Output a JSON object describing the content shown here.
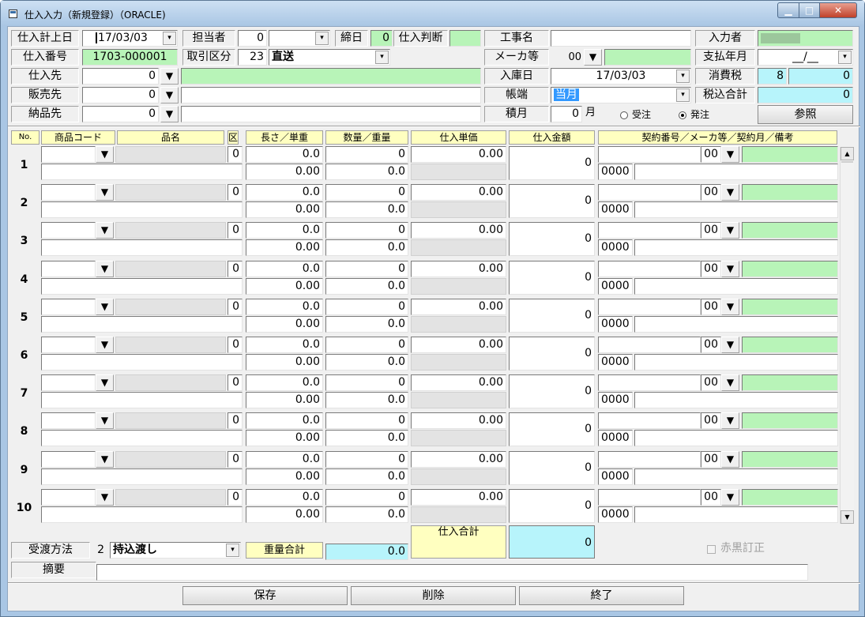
{
  "window": {
    "title": "仕入入力（新規登録）（ORACLE)",
    "minimize": "▁",
    "maximize": "□",
    "close": "✕"
  },
  "header": {
    "shiire_keijo_label": "仕入計上日",
    "shiire_keijo_value": "17/03/03",
    "tantosha_label": "担当者",
    "tantosha_code": "0",
    "tantosha_name": "",
    "shime_label": "締日",
    "shime_value": "0",
    "handan_label": "仕入判断",
    "handan_value": "",
    "koji_label": "工事名",
    "koji_value": "",
    "nyuryoku_label": "入力者",
    "nyuryoku_value": "",
    "bango_label": "仕入番号",
    "bango_value": "1703-000001",
    "torihiki_label": "取引区分",
    "torihiki_code": "23",
    "torihiki_name": "直送",
    "maker_label": "メーカ等",
    "maker_code": "00",
    "maker_name": "",
    "shiharai_label": "支払年月",
    "shiharai_value": "__/__",
    "shiiresaki_label": "仕入先",
    "shiiresaki_code": "0",
    "shiiresaki_name": "",
    "nyuko_label": "入庫日",
    "nyuko_value": "17/03/03",
    "shohizei_label": "消費税",
    "shohizei_rate": "8",
    "shohizei_value": "0",
    "hanbai_label": "販売先",
    "hanbai_code": "0",
    "hanbai_name": "",
    "chobo_label": "帳端",
    "chobo_value": "当月",
    "zeikomi_label": "税込合計",
    "zeikomi_value": "0",
    "nohin_label": "納品先",
    "nohin_code": "0",
    "nohin_name": "",
    "tsumitsuki_label": "積月",
    "tsumitsuki_value": "0",
    "tsumitsuki_unit": "月",
    "radio_juchu": "受注",
    "radio_hatchu": "発注",
    "radio_selected": "発注",
    "sansho_button": "参照"
  },
  "grid": {
    "headers": [
      "No.",
      "商品コード",
      "品名",
      "区",
      "長さ／単重",
      "数量／重量",
      "仕入単価",
      "仕入金額",
      "契約番号／メーカ等／契約月／備考"
    ],
    "rows": [
      {
        "no": "1",
        "ku": "0",
        "nagasa": "0.0",
        "suryo": "0",
        "tanka": "0.00",
        "kingaku": "0",
        "maker": "00",
        "tanju": "0.00",
        "juryo": "0.0",
        "keiyaku": "0000"
      },
      {
        "no": "2",
        "ku": "0",
        "nagasa": "0.0",
        "suryo": "0",
        "tanka": "0.00",
        "kingaku": "0",
        "maker": "00",
        "tanju": "0.00",
        "juryo": "0.0",
        "keiyaku": "0000"
      },
      {
        "no": "3",
        "ku": "0",
        "nagasa": "0.0",
        "suryo": "0",
        "tanka": "0.00",
        "kingaku": "0",
        "maker": "00",
        "tanju": "0.00",
        "juryo": "0.0",
        "keiyaku": "0000"
      },
      {
        "no": "4",
        "ku": "0",
        "nagasa": "0.0",
        "suryo": "0",
        "tanka": "0.00",
        "kingaku": "0",
        "maker": "00",
        "tanju": "0.00",
        "juryo": "0.0",
        "keiyaku": "0000"
      },
      {
        "no": "5",
        "ku": "0",
        "nagasa": "0.0",
        "suryo": "0",
        "tanka": "0.00",
        "kingaku": "0",
        "maker": "00",
        "tanju": "0.00",
        "juryo": "0.0",
        "keiyaku": "0000"
      },
      {
        "no": "6",
        "ku": "0",
        "nagasa": "0.0",
        "suryo": "0",
        "tanka": "0.00",
        "kingaku": "0",
        "maker": "00",
        "tanju": "0.00",
        "juryo": "0.0",
        "keiyaku": "0000"
      },
      {
        "no": "7",
        "ku": "0",
        "nagasa": "0.0",
        "suryo": "0",
        "tanka": "0.00",
        "kingaku": "0",
        "maker": "00",
        "tanju": "0.00",
        "juryo": "0.0",
        "keiyaku": "0000"
      },
      {
        "no": "8",
        "ku": "0",
        "nagasa": "0.0",
        "suryo": "0",
        "tanka": "0.00",
        "kingaku": "0",
        "maker": "00",
        "tanju": "0.00",
        "juryo": "0.0",
        "keiyaku": "0000"
      },
      {
        "no": "9",
        "ku": "0",
        "nagasa": "0.0",
        "suryo": "0",
        "tanka": "0.00",
        "kingaku": "0",
        "maker": "00",
        "tanju": "0.00",
        "juryo": "0.0",
        "keiyaku": "0000"
      },
      {
        "no": "10",
        "ku": "0",
        "nagasa": "0.0",
        "suryo": "0",
        "tanka": "0.00",
        "kingaku": "0",
        "maker": "00",
        "tanju": "0.00",
        "juryo": "0.0",
        "keiyaku": "0000"
      }
    ]
  },
  "footer": {
    "juto_label": "受渡方法",
    "juto_code": "2",
    "juto_name": "持込渡し",
    "juryo_total_label": "重量合計",
    "juryo_total_value": "0.0",
    "shiire_total_label": "仕入合計",
    "shiire_total_value": "0",
    "akaguro_label": "赤黒訂正",
    "tekiyo_label": "摘要",
    "tekiyo_value": "",
    "save_button": "保存",
    "delete_button": "削除",
    "exit_button": "終了"
  },
  "icons": {
    "dropdown": "▼",
    "combo": "▾",
    "scroll_up": "▲",
    "scroll_down": "▼"
  },
  "colors": {
    "green": "#b8f4b8",
    "cyan": "#b7f4fb",
    "yellow": "#ffffc0"
  }
}
